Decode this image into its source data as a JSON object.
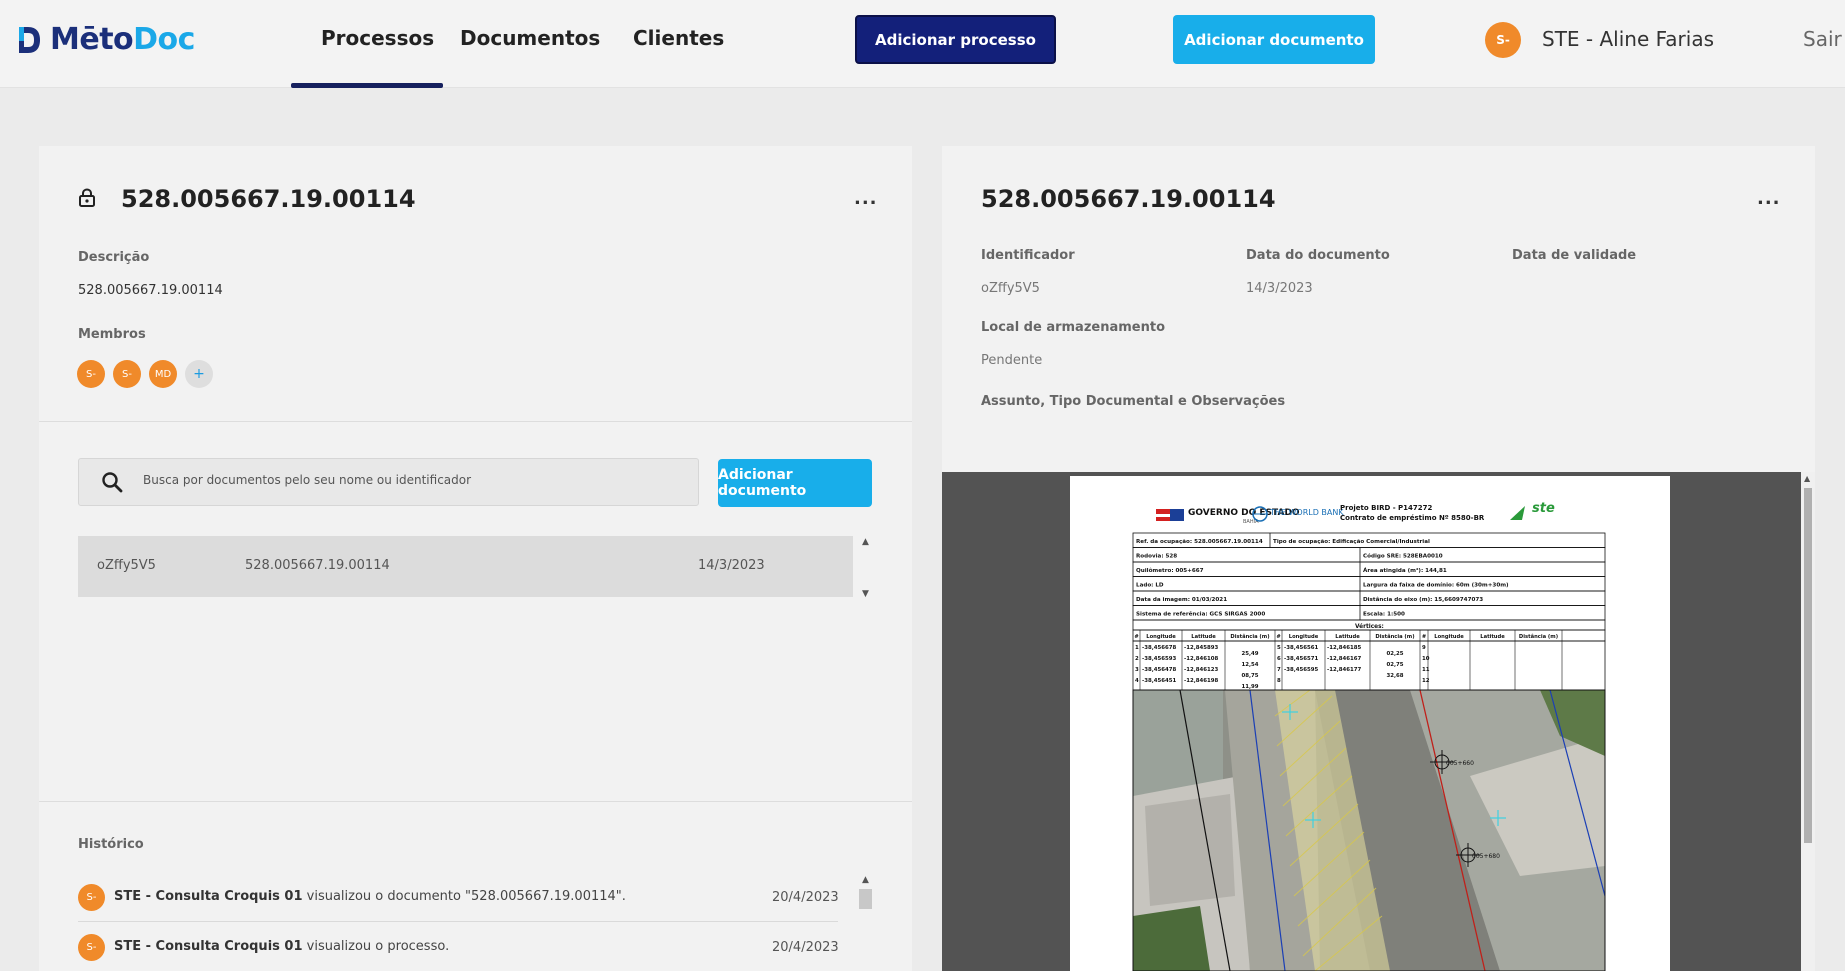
{
  "brand": {
    "part1": "Mēto",
    "part2": "Doc"
  },
  "nav": {
    "tabs": [
      {
        "label": "Processos"
      },
      {
        "label": "Documentos"
      },
      {
        "label": "Clientes"
      }
    ],
    "add_process": "Adicionar processo",
    "add_document": "Adicionar documento",
    "user_initials": "S-",
    "user_name": "STE - Aline Farias",
    "logout": "Sair"
  },
  "process": {
    "number": "528.005667.19.00114",
    "more": "...",
    "description_label": "Descrição",
    "description": "528.005667.19.00114",
    "members_label": "Membros",
    "members": [
      "S-",
      "S-",
      "MD"
    ],
    "add_member": "+",
    "search_placeholder": "Busca por documentos pelo seu nome ou identificador",
    "add_document": "Adicionar documento",
    "documents": [
      {
        "id": "oZffy5V5",
        "name": "528.005667.19.00114",
        "date": "14/3/2023"
      }
    ],
    "history_label": "Histórico",
    "history": [
      {
        "initials": "S-",
        "user": "STE - Consulta Croquis 01",
        "action": "visualizou o documento \"528.005667.19.00114\".",
        "date": "20/4/2023"
      },
      {
        "initials": "S-",
        "user": "STE - Consulta Croquis 01",
        "action": "visualizou o processo.",
        "date": "20/4/2023"
      }
    ]
  },
  "document": {
    "number": "528.005667.19.00114",
    "more": "...",
    "identifier_label": "Identificador",
    "identifier": "oZffy5V5",
    "date_label": "Data do documento",
    "date": "14/3/2023",
    "validity_label": "Data de validade",
    "storage_label": "Local de armazenamento",
    "storage": "Pendente",
    "subject_label": "Assunto, Tipo Documental e Observações"
  },
  "sheet": {
    "gov": "GOVERNO DO ESTADO",
    "gov_sub": "BAHIA",
    "worldbank": "THE WORLD BANK",
    "project": "Projeto BIRD - P147272",
    "contract": "Contrato de empréstimo Nº 8580-BR",
    "ste": "ste",
    "rows": [
      [
        "Ref. da ocupação: 528.005667.19.00114",
        "Tipo de ocupação: Edificação Comercial/Industrial"
      ],
      [
        "Rodovia: 528",
        "Código SRE: 528EBA0010"
      ],
      [
        "Quilômetro: 005+667",
        "Área atingida (m²): 144,81"
      ],
      [
        "Lado: LD",
        "Largura da faixa de domínio: 60m (30m+30m)"
      ],
      [
        "Data da imagem: 01/03/2021",
        "Distância do eixo (m): 15,6609747073"
      ],
      [
        "Sistema de referência: GCS SIRGAS 2000",
        "Escala: 1:500"
      ]
    ],
    "vertices_title": "Vértices:",
    "vertex_headers": [
      "#",
      "Longitude",
      "Latitude",
      "Distância (m)",
      "#",
      "Longitude",
      "Latitude",
      "Distância (m)",
      "#",
      "Longitude",
      "Latitude",
      "Distância (m)"
    ],
    "vertex_rows": [
      [
        "1",
        "-38,456678",
        "-12,845893",
        "25,49",
        "5",
        "-38,456561",
        "-12,846185",
        "02,25",
        "9",
        "",
        "",
        ""
      ],
      [
        "2",
        "-38,456593",
        "-12,846108",
        "12,54",
        "6",
        "-38,456571",
        "-12,846167",
        "02,75",
        "10",
        "",
        "",
        ""
      ],
      [
        "3",
        "-38,456478",
        "-12,846123",
        "08,75",
        "7",
        "-38,456595",
        "-12,846177",
        "32,68",
        "11",
        "",
        "",
        ""
      ],
      [
        "4",
        "-38,456451",
        "-12,846198",
        "11,99",
        "8",
        "",
        "",
        "",
        "12",
        "",
        "",
        ""
      ]
    ],
    "map_label_1": "005+660",
    "map_label_2": "005+680"
  },
  "colors": {
    "navy": "#13207a",
    "cyan": "#18aeea",
    "avatar": "#f08a2a"
  }
}
